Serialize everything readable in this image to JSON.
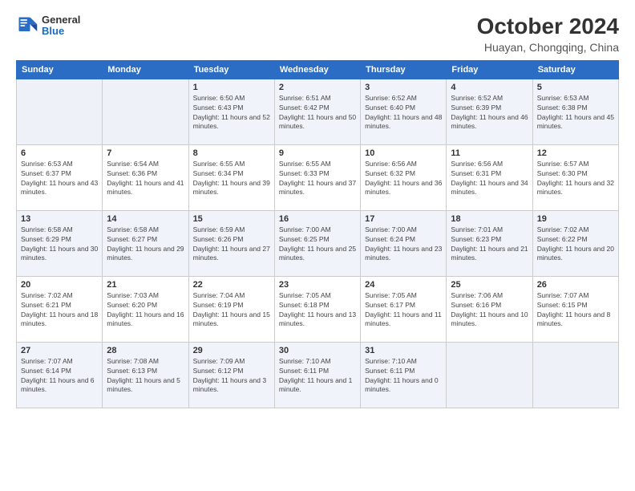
{
  "logo": {
    "line1": "General",
    "line2": "Blue"
  },
  "title": "October 2024",
  "location": "Huayan, Chongqing, China",
  "weekdays": [
    "Sunday",
    "Monday",
    "Tuesday",
    "Wednesday",
    "Thursday",
    "Friday",
    "Saturday"
  ],
  "weeks": [
    [
      {
        "day": "",
        "sunrise": "",
        "sunset": "",
        "daylight": ""
      },
      {
        "day": "",
        "sunrise": "",
        "sunset": "",
        "daylight": ""
      },
      {
        "day": "1",
        "sunrise": "Sunrise: 6:50 AM",
        "sunset": "Sunset: 6:43 PM",
        "daylight": "Daylight: 11 hours and 52 minutes."
      },
      {
        "day": "2",
        "sunrise": "Sunrise: 6:51 AM",
        "sunset": "Sunset: 6:42 PM",
        "daylight": "Daylight: 11 hours and 50 minutes."
      },
      {
        "day": "3",
        "sunrise": "Sunrise: 6:52 AM",
        "sunset": "Sunset: 6:40 PM",
        "daylight": "Daylight: 11 hours and 48 minutes."
      },
      {
        "day": "4",
        "sunrise": "Sunrise: 6:52 AM",
        "sunset": "Sunset: 6:39 PM",
        "daylight": "Daylight: 11 hours and 46 minutes."
      },
      {
        "day": "5",
        "sunrise": "Sunrise: 6:53 AM",
        "sunset": "Sunset: 6:38 PM",
        "daylight": "Daylight: 11 hours and 45 minutes."
      }
    ],
    [
      {
        "day": "6",
        "sunrise": "Sunrise: 6:53 AM",
        "sunset": "Sunset: 6:37 PM",
        "daylight": "Daylight: 11 hours and 43 minutes."
      },
      {
        "day": "7",
        "sunrise": "Sunrise: 6:54 AM",
        "sunset": "Sunset: 6:36 PM",
        "daylight": "Daylight: 11 hours and 41 minutes."
      },
      {
        "day": "8",
        "sunrise": "Sunrise: 6:55 AM",
        "sunset": "Sunset: 6:34 PM",
        "daylight": "Daylight: 11 hours and 39 minutes."
      },
      {
        "day": "9",
        "sunrise": "Sunrise: 6:55 AM",
        "sunset": "Sunset: 6:33 PM",
        "daylight": "Daylight: 11 hours and 37 minutes."
      },
      {
        "day": "10",
        "sunrise": "Sunrise: 6:56 AM",
        "sunset": "Sunset: 6:32 PM",
        "daylight": "Daylight: 11 hours and 36 minutes."
      },
      {
        "day": "11",
        "sunrise": "Sunrise: 6:56 AM",
        "sunset": "Sunset: 6:31 PM",
        "daylight": "Daylight: 11 hours and 34 minutes."
      },
      {
        "day": "12",
        "sunrise": "Sunrise: 6:57 AM",
        "sunset": "Sunset: 6:30 PM",
        "daylight": "Daylight: 11 hours and 32 minutes."
      }
    ],
    [
      {
        "day": "13",
        "sunrise": "Sunrise: 6:58 AM",
        "sunset": "Sunset: 6:29 PM",
        "daylight": "Daylight: 11 hours and 30 minutes."
      },
      {
        "day": "14",
        "sunrise": "Sunrise: 6:58 AM",
        "sunset": "Sunset: 6:27 PM",
        "daylight": "Daylight: 11 hours and 29 minutes."
      },
      {
        "day": "15",
        "sunrise": "Sunrise: 6:59 AM",
        "sunset": "Sunset: 6:26 PM",
        "daylight": "Daylight: 11 hours and 27 minutes."
      },
      {
        "day": "16",
        "sunrise": "Sunrise: 7:00 AM",
        "sunset": "Sunset: 6:25 PM",
        "daylight": "Daylight: 11 hours and 25 minutes."
      },
      {
        "day": "17",
        "sunrise": "Sunrise: 7:00 AM",
        "sunset": "Sunset: 6:24 PM",
        "daylight": "Daylight: 11 hours and 23 minutes."
      },
      {
        "day": "18",
        "sunrise": "Sunrise: 7:01 AM",
        "sunset": "Sunset: 6:23 PM",
        "daylight": "Daylight: 11 hours and 21 minutes."
      },
      {
        "day": "19",
        "sunrise": "Sunrise: 7:02 AM",
        "sunset": "Sunset: 6:22 PM",
        "daylight": "Daylight: 11 hours and 20 minutes."
      }
    ],
    [
      {
        "day": "20",
        "sunrise": "Sunrise: 7:02 AM",
        "sunset": "Sunset: 6:21 PM",
        "daylight": "Daylight: 11 hours and 18 minutes."
      },
      {
        "day": "21",
        "sunrise": "Sunrise: 7:03 AM",
        "sunset": "Sunset: 6:20 PM",
        "daylight": "Daylight: 11 hours and 16 minutes."
      },
      {
        "day": "22",
        "sunrise": "Sunrise: 7:04 AM",
        "sunset": "Sunset: 6:19 PM",
        "daylight": "Daylight: 11 hours and 15 minutes."
      },
      {
        "day": "23",
        "sunrise": "Sunrise: 7:05 AM",
        "sunset": "Sunset: 6:18 PM",
        "daylight": "Daylight: 11 hours and 13 minutes."
      },
      {
        "day": "24",
        "sunrise": "Sunrise: 7:05 AM",
        "sunset": "Sunset: 6:17 PM",
        "daylight": "Daylight: 11 hours and 11 minutes."
      },
      {
        "day": "25",
        "sunrise": "Sunrise: 7:06 AM",
        "sunset": "Sunset: 6:16 PM",
        "daylight": "Daylight: 11 hours and 10 minutes."
      },
      {
        "day": "26",
        "sunrise": "Sunrise: 7:07 AM",
        "sunset": "Sunset: 6:15 PM",
        "daylight": "Daylight: 11 hours and 8 minutes."
      }
    ],
    [
      {
        "day": "27",
        "sunrise": "Sunrise: 7:07 AM",
        "sunset": "Sunset: 6:14 PM",
        "daylight": "Daylight: 11 hours and 6 minutes."
      },
      {
        "day": "28",
        "sunrise": "Sunrise: 7:08 AM",
        "sunset": "Sunset: 6:13 PM",
        "daylight": "Daylight: 11 hours and 5 minutes."
      },
      {
        "day": "29",
        "sunrise": "Sunrise: 7:09 AM",
        "sunset": "Sunset: 6:12 PM",
        "daylight": "Daylight: 11 hours and 3 minutes."
      },
      {
        "day": "30",
        "sunrise": "Sunrise: 7:10 AM",
        "sunset": "Sunset: 6:11 PM",
        "daylight": "Daylight: 11 hours and 1 minute."
      },
      {
        "day": "31",
        "sunrise": "Sunrise: 7:10 AM",
        "sunset": "Sunset: 6:11 PM",
        "daylight": "Daylight: 11 hours and 0 minutes."
      },
      {
        "day": "",
        "sunrise": "",
        "sunset": "",
        "daylight": ""
      },
      {
        "day": "",
        "sunrise": "",
        "sunset": "",
        "daylight": ""
      }
    ]
  ]
}
